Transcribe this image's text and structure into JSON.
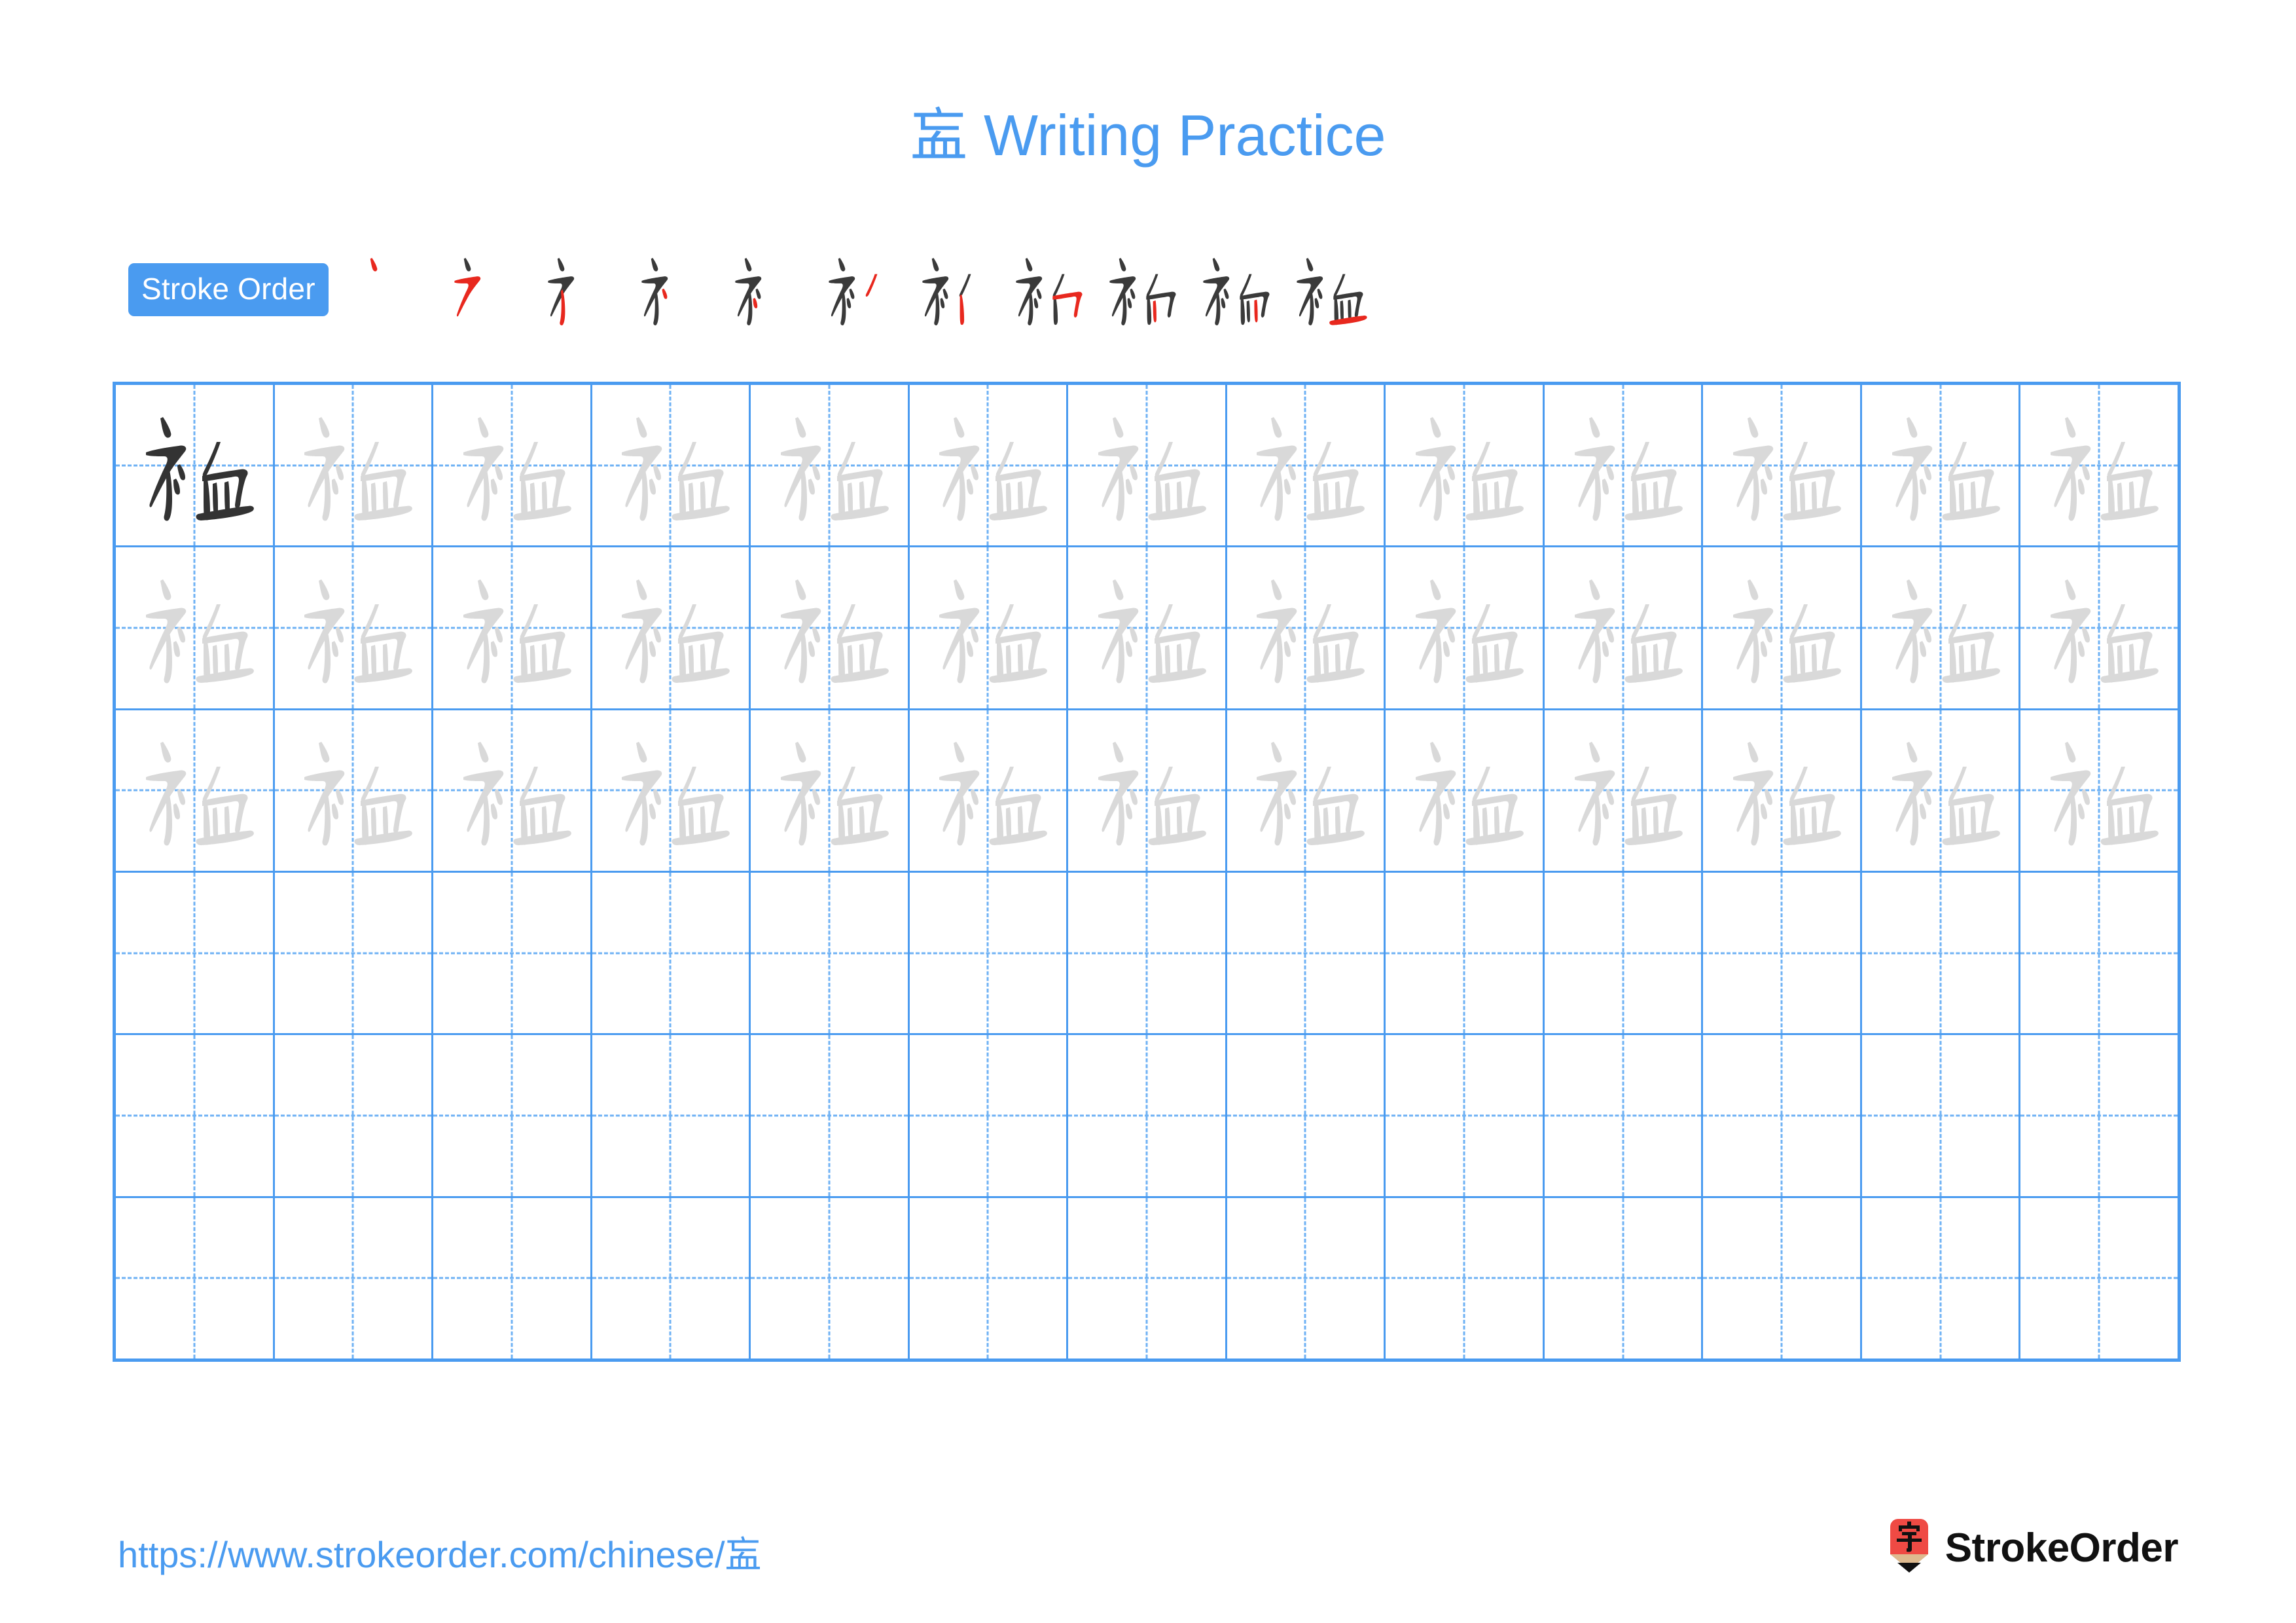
{
  "page": {
    "character": "衁",
    "title_suffix": " Writing Practice",
    "title_full": "衁 Writing Practice",
    "accent_color": "#4a9bf0",
    "grid_line_color": "#4a9bf0",
    "guide_line_color": "#6fb2f4",
    "model_char_color": "#333333",
    "trace_char_color": "#d9d9d9",
    "new_stroke_color": "#e8281e"
  },
  "stroke_order": {
    "badge_label": "Stroke Order",
    "stroke_count": 11,
    "steps": [
      {
        "index": 1,
        "new_stroke_color": "#e8281e",
        "prior_strokes": 0
      },
      {
        "index": 2,
        "new_stroke_color": "#e8281e",
        "prior_strokes": 1
      },
      {
        "index": 3,
        "new_stroke_color": "#e8281e",
        "prior_strokes": 2
      },
      {
        "index": 4,
        "new_stroke_color": "#e8281e",
        "prior_strokes": 3
      },
      {
        "index": 5,
        "new_stroke_color": "#e8281e",
        "prior_strokes": 4
      },
      {
        "index": 6,
        "new_stroke_color": "#e8281e",
        "prior_strokes": 5
      },
      {
        "index": 7,
        "new_stroke_color": "#e8281e",
        "prior_strokes": 6
      },
      {
        "index": 8,
        "new_stroke_color": "#e8281e",
        "prior_strokes": 7
      },
      {
        "index": 9,
        "new_stroke_color": "#e8281e",
        "prior_strokes": 8
      },
      {
        "index": 10,
        "new_stroke_color": "#e8281e",
        "prior_strokes": 9
      },
      {
        "index": 11,
        "new_stroke_color": "#e8281e",
        "prior_strokes": 10
      }
    ]
  },
  "practice_grid": {
    "rows": 6,
    "columns": 13,
    "filled_rows": 3,
    "empty_rows": 3,
    "row_contents": [
      {
        "row": 1,
        "cells": [
          "model",
          "trace",
          "trace",
          "trace",
          "trace",
          "trace",
          "trace",
          "trace",
          "trace",
          "trace",
          "trace",
          "trace",
          "trace"
        ]
      },
      {
        "row": 2,
        "cells": [
          "trace",
          "trace",
          "trace",
          "trace",
          "trace",
          "trace",
          "trace",
          "trace",
          "trace",
          "trace",
          "trace",
          "trace",
          "trace"
        ]
      },
      {
        "row": 3,
        "cells": [
          "trace",
          "trace",
          "trace",
          "trace",
          "trace",
          "trace",
          "trace",
          "trace",
          "trace",
          "trace",
          "trace",
          "trace",
          "trace"
        ]
      },
      {
        "row": 4,
        "cells": [
          "",
          "",
          "",
          "",
          "",
          "",
          "",
          "",
          "",
          "",
          "",
          "",
          ""
        ]
      },
      {
        "row": 5,
        "cells": [
          "",
          "",
          "",
          "",
          "",
          "",
          "",
          "",
          "",
          "",
          "",
          "",
          ""
        ]
      },
      {
        "row": 6,
        "cells": [
          "",
          "",
          "",
          "",
          "",
          "",
          "",
          "",
          "",
          "",
          "",
          "",
          ""
        ]
      }
    ]
  },
  "footer": {
    "url": "https://www.strokeorder.com/chinese/衁",
    "url_prefix": "https://www.strokeorder.com/chinese/",
    "brand_name": "StrokeOrder",
    "logo_glyph": "字",
    "logo_body_color": "#ef4a44",
    "logo_wood_color": "#deba8f",
    "logo_tip_color": "#111111"
  }
}
